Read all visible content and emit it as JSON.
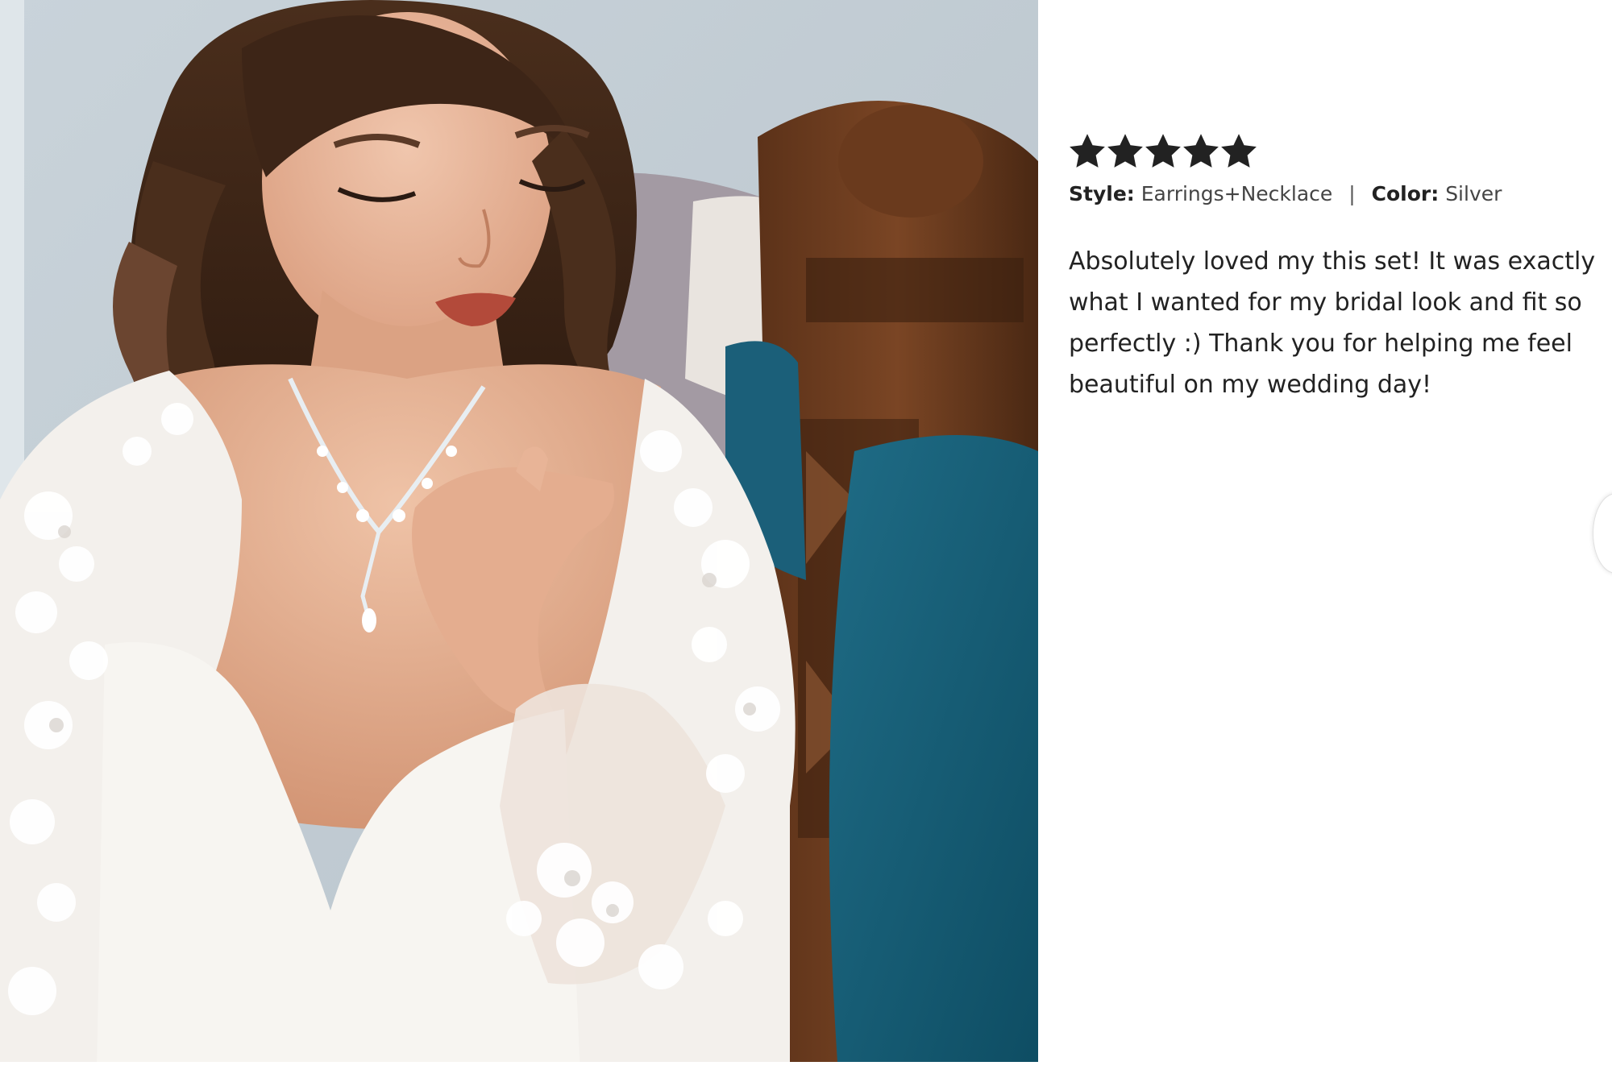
{
  "review": {
    "rating": 5,
    "rating_max": 5,
    "star_icon": "star-icon",
    "star_color": "#222222",
    "photo_alt": "",
    "style_label": "Style:",
    "style_value": "Earrings+Necklace",
    "divider": "|",
    "color_label": "Color:",
    "color_value": "Silver",
    "text": "Absolutely loved my this set! It was exactly what I wanted for my bridal look and fit so perfectly :) Thank you for helping me feel beautiful on my wedding day!"
  },
  "carousel": {
    "next_icon": "chevron-right-icon"
  }
}
